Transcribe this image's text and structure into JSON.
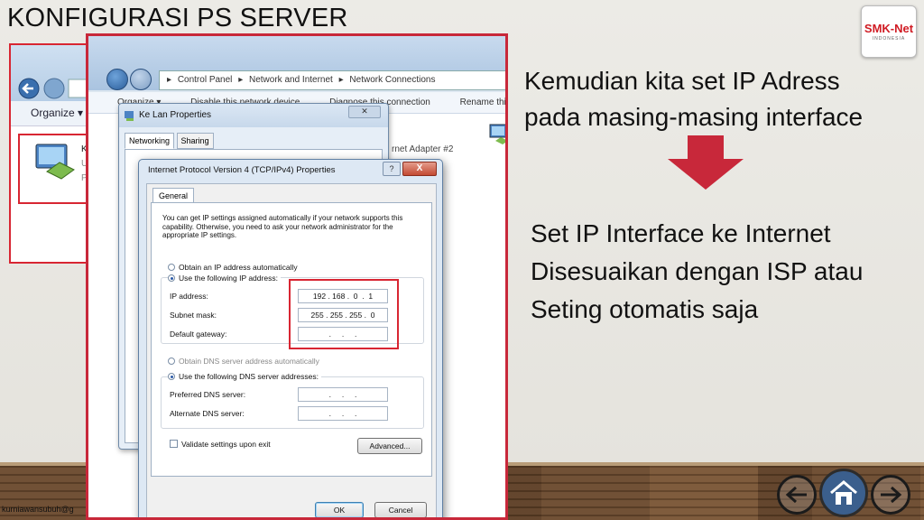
{
  "slide": {
    "title": "KONFIGURASI PS SERVER",
    "logo_text": "SMK-Net",
    "logo_sub": "INDONESIA",
    "heading_lines": [
      "Kemudian kita set IP Adress",
      "pada masing-masing interface"
    ],
    "body_lines": [
      "Set IP Interface ke Internet",
      "Disesuaikan dengan ISP atau",
      "Seting otomatis saja"
    ],
    "credit": "kurniawansubuh@g",
    "accent_color": "#c8283a"
  },
  "explorer": {
    "breadcrumb": [
      "Control Panel",
      "Network and Internet",
      "Network Connections"
    ],
    "toolbar": [
      "Organize ▾",
      "Disable this network device",
      "Diagnose this connection",
      "Rename this conne"
    ],
    "adapter_label": "rnet Adapter #2",
    "left_organize": "Organize ▾"
  },
  "lan_dialog": {
    "title": "Ke Lan Properties",
    "tabs": [
      "Networking",
      "Sharing"
    ]
  },
  "ipv4_dialog": {
    "title": "Internet Protocol Version 4 (TCP/IPv4) Properties",
    "help": "?",
    "close": "X",
    "tab": "General",
    "description": "You can get IP settings assigned automatically if your network supports this capability. Otherwise, you need to ask your network administrator for the appropriate IP settings.",
    "radio_auto_ip": "Obtain an IP address automatically",
    "radio_manual_ip": "Use the following IP address:",
    "ip_label": "IP address:",
    "ip_value": "192 . 168 .  0  .  1",
    "mask_label": "Subnet mask:",
    "mask_value": "255 . 255 . 255 .  0",
    "gateway_label": "Default gateway:",
    "gateway_value": "  .     .     .  ",
    "radio_auto_dns": "Obtain DNS server address automatically",
    "radio_manual_dns": "Use the following DNS server addresses:",
    "pref_dns_label": "Preferred DNS server:",
    "pref_dns_value": "  .     .     .  ",
    "alt_dns_label": "Alternate DNS server:",
    "alt_dns_value": "  .     .     .  ",
    "validate_label": "Validate settings upon exit",
    "advanced_label": "Advanced...",
    "ok_label": "OK",
    "cancel_label": "Cancel"
  }
}
